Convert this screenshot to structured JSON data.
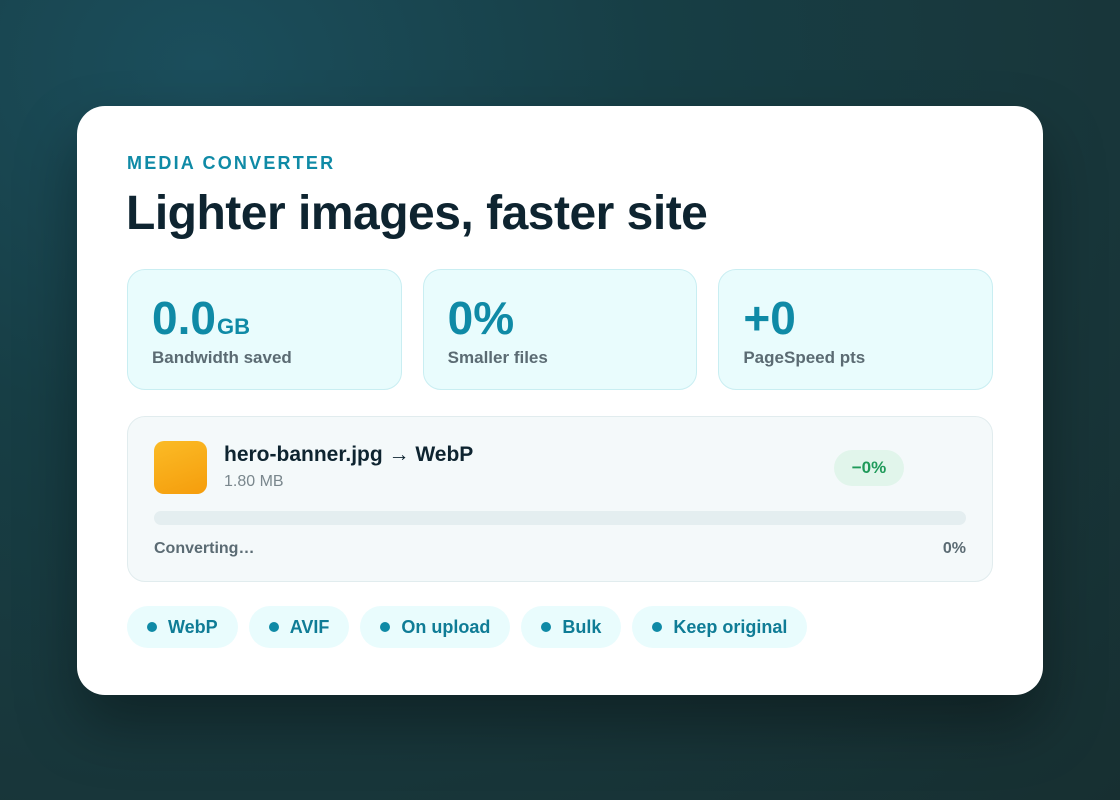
{
  "header": {
    "eyebrow": "MEDIA CONVERTER",
    "title": "Lighter images, faster site"
  },
  "stats": [
    {
      "value": "0.0",
      "unit": "GB",
      "label": "Bandwidth saved"
    },
    {
      "value": "0%",
      "unit": "",
      "label": "Smaller files"
    },
    {
      "value": "+0",
      "unit": "",
      "label": "PageSpeed pts"
    }
  ],
  "job": {
    "thumb_icon": "image-file-icon",
    "file_name": "hero-banner.jpg → WebP",
    "file_size": "1.80 MB",
    "savings_badge": "−0%",
    "status": "Converting…",
    "progress_label": "0%",
    "progress": 0
  },
  "chips": [
    {
      "label": "WebP"
    },
    {
      "label": "AVIF"
    },
    {
      "label": "On upload"
    },
    {
      "label": "Bulk"
    },
    {
      "label": "Keep original"
    }
  ],
  "colors": {
    "accent": "#0f8aa6",
    "title": "#0e2430",
    "success": "#1f9a5a",
    "thumb": "#f7a915"
  }
}
